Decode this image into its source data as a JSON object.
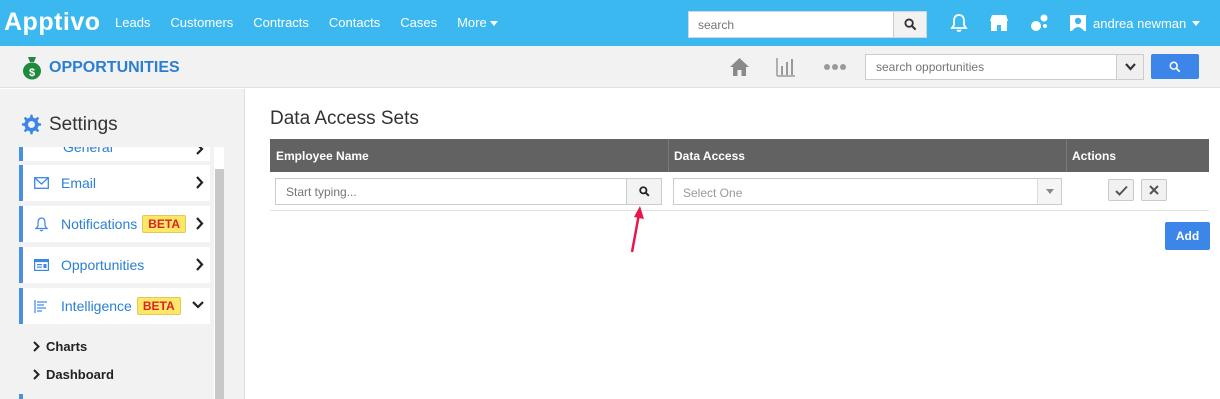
{
  "topbar": {
    "logo": "Apptivo",
    "nav": [
      "Leads",
      "Customers",
      "Contracts",
      "Contacts",
      "Cases",
      "More"
    ],
    "search_placeholder": "search",
    "user_name": "andrea newman"
  },
  "subbar": {
    "app_title": "OPPORTUNITIES",
    "search_placeholder": "search opportunities"
  },
  "sidebar": {
    "title": "Settings",
    "partial_item": "General",
    "items": [
      {
        "label": "Email",
        "icon": "envelope-icon"
      },
      {
        "label": "Notifications",
        "icon": "bell-icon",
        "badge": "BETA"
      },
      {
        "label": "Opportunities",
        "icon": "card-icon"
      },
      {
        "label": "Intelligence",
        "icon": "list-icon",
        "badge": "BETA"
      }
    ],
    "sub_items": [
      "Charts",
      "Dashboard"
    ]
  },
  "main": {
    "title": "Data Access Sets",
    "columns": [
      "Employee Name",
      "Data Access",
      "Actions"
    ],
    "employee_placeholder": "Start typing...",
    "data_access_selected": "Select One",
    "add_label": "Add"
  },
  "colors": {
    "topbar": "#3cb8f0",
    "accent": "#3b86e8",
    "header": "#626262",
    "beta_bg": "#fde767",
    "beta_text": "#d8232a",
    "annotation_arrow": "#e8174b"
  }
}
